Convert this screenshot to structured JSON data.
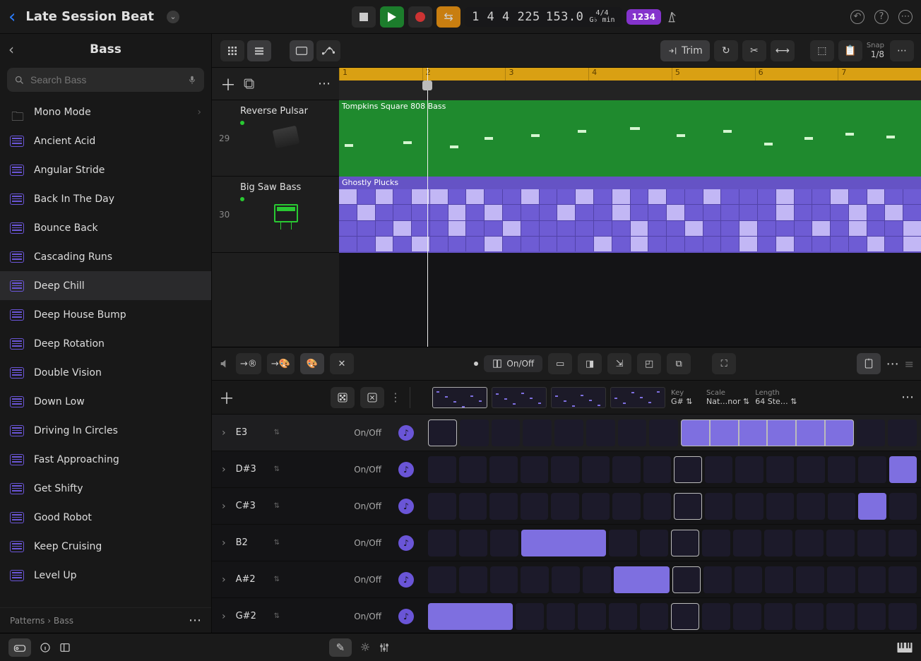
{
  "project": {
    "title": "Late Session Beat"
  },
  "transport": {
    "display": "1 4 4 225",
    "tempo": "153.0",
    "sig_top": "4/4",
    "sig_bot": "G♭ min",
    "count_label": "1234"
  },
  "sidebar": {
    "title": "Bass",
    "search_placeholder": "Search Bass",
    "breadcrumb_a": "Patterns",
    "breadcrumb_b": "Bass",
    "selected": "Deep Chill",
    "folder": {
      "label": "Mono Mode"
    },
    "items": [
      {
        "label": "Ancient Acid"
      },
      {
        "label": "Angular Stride"
      },
      {
        "label": "Back In The Day"
      },
      {
        "label": "Bounce Back"
      },
      {
        "label": "Cascading Runs"
      },
      {
        "label": "Deep Chill"
      },
      {
        "label": "Deep House Bump"
      },
      {
        "label": "Deep Rotation"
      },
      {
        "label": "Double Vision"
      },
      {
        "label": "Down Low"
      },
      {
        "label": "Driving In Circles"
      },
      {
        "label": "Fast Approaching"
      },
      {
        "label": "Get Shifty"
      },
      {
        "label": "Good Robot"
      },
      {
        "label": "Keep Cruising"
      },
      {
        "label": "Level Up"
      }
    ]
  },
  "tracks_toolbar": {
    "trim_label": "Trim",
    "snap_label": "Snap",
    "snap_value": "1/8"
  },
  "ruler": [
    "1",
    "2",
    "3",
    "4",
    "5",
    "6",
    "7"
  ],
  "tracks": [
    {
      "num": "29",
      "name": "Reverse Pulsar",
      "region": "Tompkins Square 808 Bass"
    },
    {
      "num": "30",
      "name": "Big Saw Bass",
      "region": "Ghostly Plucks"
    }
  ],
  "seq_toolbar": {
    "onoff": "On/Off"
  },
  "seq_params": {
    "key_label": "Key",
    "key": "G#",
    "scale_label": "Scale",
    "scale": "Nat…nor",
    "length_label": "Length",
    "length": "64 Ste…"
  },
  "step_rows": [
    {
      "note": "E3",
      "mode": "On/Off",
      "steps": [
        0,
        0,
        0,
        0,
        0,
        0,
        0,
        0,
        2,
        2,
        2,
        2,
        2,
        2,
        0,
        0
      ],
      "outline": [
        1,
        0,
        0,
        0,
        0,
        0,
        0,
        0,
        1,
        1,
        1,
        1,
        1,
        1,
        0,
        0
      ]
    },
    {
      "note": "D#3",
      "mode": "On/Off",
      "steps": [
        0,
        0,
        0,
        0,
        0,
        0,
        0,
        0,
        0,
        0,
        0,
        0,
        0,
        0,
        0,
        2
      ],
      "outline": [
        0,
        0,
        0,
        0,
        0,
        0,
        0,
        0,
        1,
        0,
        0,
        0,
        0,
        0,
        0,
        0
      ]
    },
    {
      "note": "C#3",
      "mode": "On/Off",
      "steps": [
        0,
        0,
        0,
        0,
        0,
        0,
        0,
        0,
        0,
        0,
        0,
        0,
        0,
        0,
        2,
        0
      ],
      "outline": [
        0,
        0,
        0,
        0,
        0,
        0,
        0,
        0,
        1,
        0,
        0,
        0,
        0,
        0,
        0,
        0
      ]
    },
    {
      "note": "B2",
      "mode": "On/Off",
      "steps": [
        0,
        0,
        0,
        2,
        2,
        2,
        0,
        0,
        0,
        0,
        0,
        0,
        0,
        0,
        0,
        0
      ],
      "outline": [
        0,
        0,
        0,
        0,
        0,
        0,
        0,
        0,
        1,
        0,
        0,
        0,
        0,
        0,
        0,
        0
      ]
    },
    {
      "note": "A#2",
      "mode": "On/Off",
      "steps": [
        0,
        0,
        0,
        0,
        0,
        0,
        2,
        2,
        0,
        0,
        0,
        0,
        0,
        0,
        0,
        0
      ],
      "outline": [
        0,
        0,
        0,
        0,
        0,
        0,
        0,
        0,
        1,
        0,
        0,
        0,
        0,
        0,
        0,
        0
      ]
    },
    {
      "note": "G#2",
      "mode": "On/Off",
      "steps": [
        2,
        2,
        2,
        0,
        0,
        0,
        0,
        0,
        0,
        0,
        0,
        0,
        0,
        0,
        0,
        0
      ],
      "outline": [
        0,
        0,
        0,
        0,
        0,
        0,
        0,
        0,
        1,
        0,
        0,
        0,
        0,
        0,
        0,
        0
      ]
    }
  ]
}
